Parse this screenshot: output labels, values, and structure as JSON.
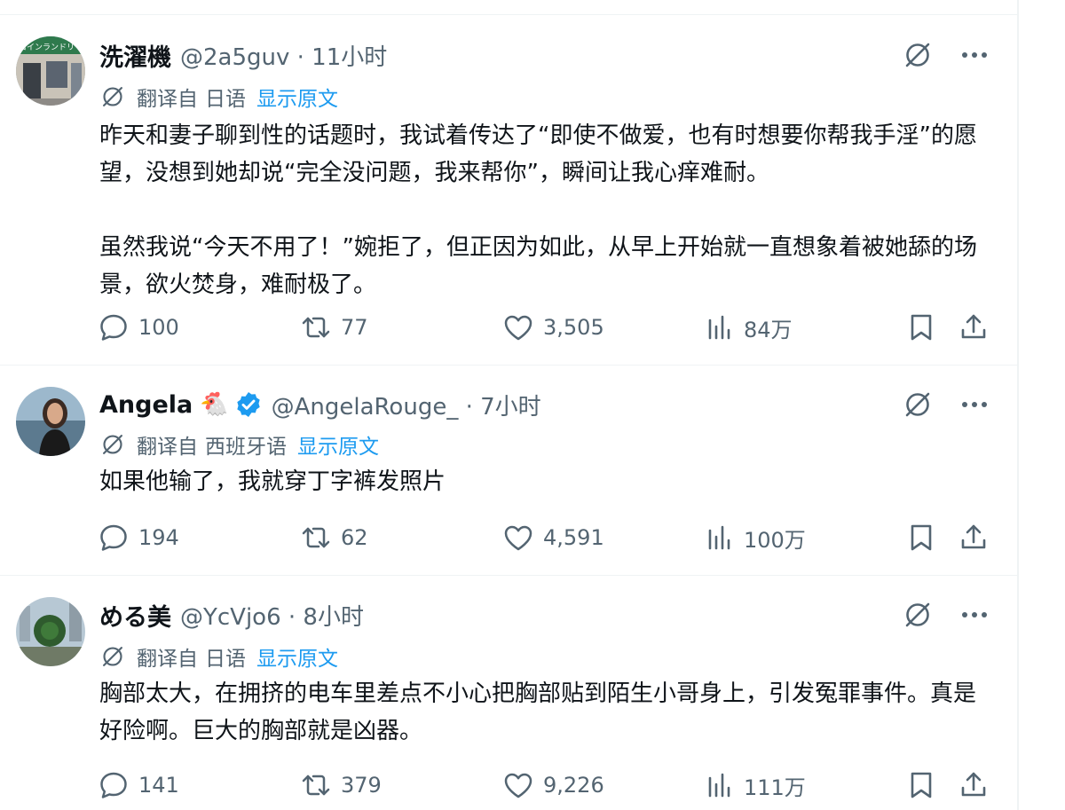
{
  "tweets": [
    {
      "name": "洗濯機",
      "handle": "@2a5guv · 11小时",
      "emoji": "",
      "verified": false,
      "translate": {
        "prefix": "翻译自",
        "lang": "日语",
        "show": "显示原文"
      },
      "paragraphs": [
        "昨天和妻子聊到性的话题时，我试着传达了“即使不做爱，也有时想要你帮我手淫”的愿望，没想到她却说“完全没问题，我来帮你”，瞬间让我心痒难耐。",
        "虽然我说“今天不用了！”婉拒了，但正因为如此，从早上开始就一直想象着被她舔的场景，欲火焚身，难耐极了。"
      ],
      "stats": {
        "replies": "100",
        "retweets": "77",
        "likes": "3,505",
        "views": "84万"
      }
    },
    {
      "name": "Angela",
      "handle": "@AngelaRouge_ · 7小时",
      "emoji": "🐔",
      "verified": true,
      "translate": {
        "prefix": "翻译自",
        "lang": "西班牙语",
        "show": "显示原文"
      },
      "paragraphs": [
        "如果他输了，我就穿丁字裤发照片"
      ],
      "stats": {
        "replies": "194",
        "retweets": "62",
        "likes": "4,591",
        "views": "100万"
      }
    },
    {
      "name": "める美",
      "handle": "@YcVjo6 · 8小时",
      "emoji": "",
      "verified": false,
      "translate": {
        "prefix": "翻译自",
        "lang": "日语",
        "show": "显示原文"
      },
      "paragraphs": [
        "胸部太大，在拥挤的电车里差点不小心把胸部贴到陌生小哥身上，引发冤罪事件。真是好险啊。巨大的胸部就是凶器。"
      ],
      "stats": {
        "replies": "141",
        "retweets": "379",
        "likes": "9,226",
        "views": "111万"
      }
    }
  ],
  "colors": {
    "accent": "#1d9bf0",
    "muted": "#536471",
    "text": "#0f1419",
    "divider": "#eff3f4"
  }
}
